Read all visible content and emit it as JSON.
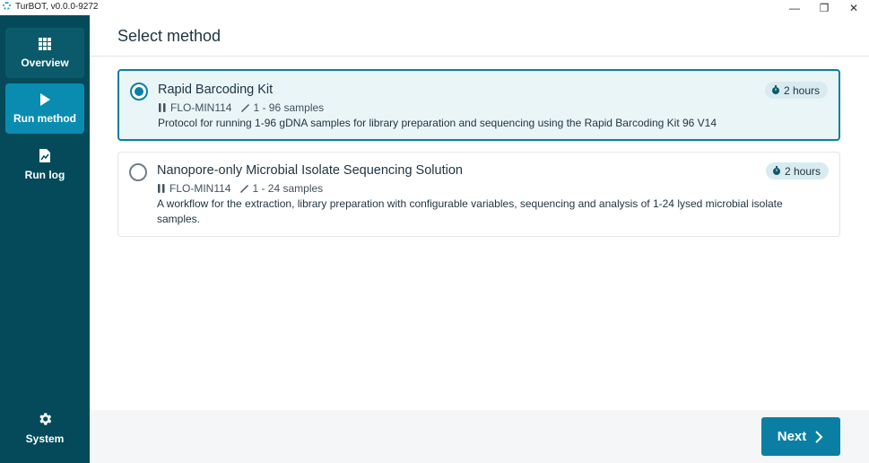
{
  "window": {
    "title": "TurBOT, v0.0.0-9272",
    "minimize": "—",
    "restore": "❐",
    "close": "✕"
  },
  "sidebar": {
    "items": [
      {
        "label": "Overview",
        "icon": "grid-icon"
      },
      {
        "label": "Run method",
        "icon": "play-icon"
      },
      {
        "label": "Run log",
        "icon": "document-icon"
      },
      {
        "label": "System",
        "icon": "gear-icon"
      }
    ],
    "active_color": "#0a8cb0",
    "background": "#044a5a"
  },
  "header": {
    "title": "Select method"
  },
  "methods": [
    {
      "title": "Rapid Barcoding Kit",
      "flowcell": "FLO-MIN114",
      "samples": "1 - 96 samples",
      "description": "Protocol for running 1-96 gDNA samples for library preparation and sequencing using the Rapid Barcoding Kit 96 V14",
      "duration": "2 hours",
      "selected": true
    },
    {
      "title": "Nanopore-only Microbial Isolate Sequencing Solution",
      "flowcell": "FLO-MIN114",
      "samples": "1 - 24 samples",
      "description": "A workflow for the extraction, library preparation with configurable variables, sequencing and analysis of 1-24 lysed microbial isolate samples.",
      "duration": "2 hours",
      "selected": false
    }
  ],
  "footer": {
    "next_label": "Next"
  },
  "colors": {
    "accent": "#0b7fa3",
    "selected_card_bg": "#eaf5f7"
  }
}
